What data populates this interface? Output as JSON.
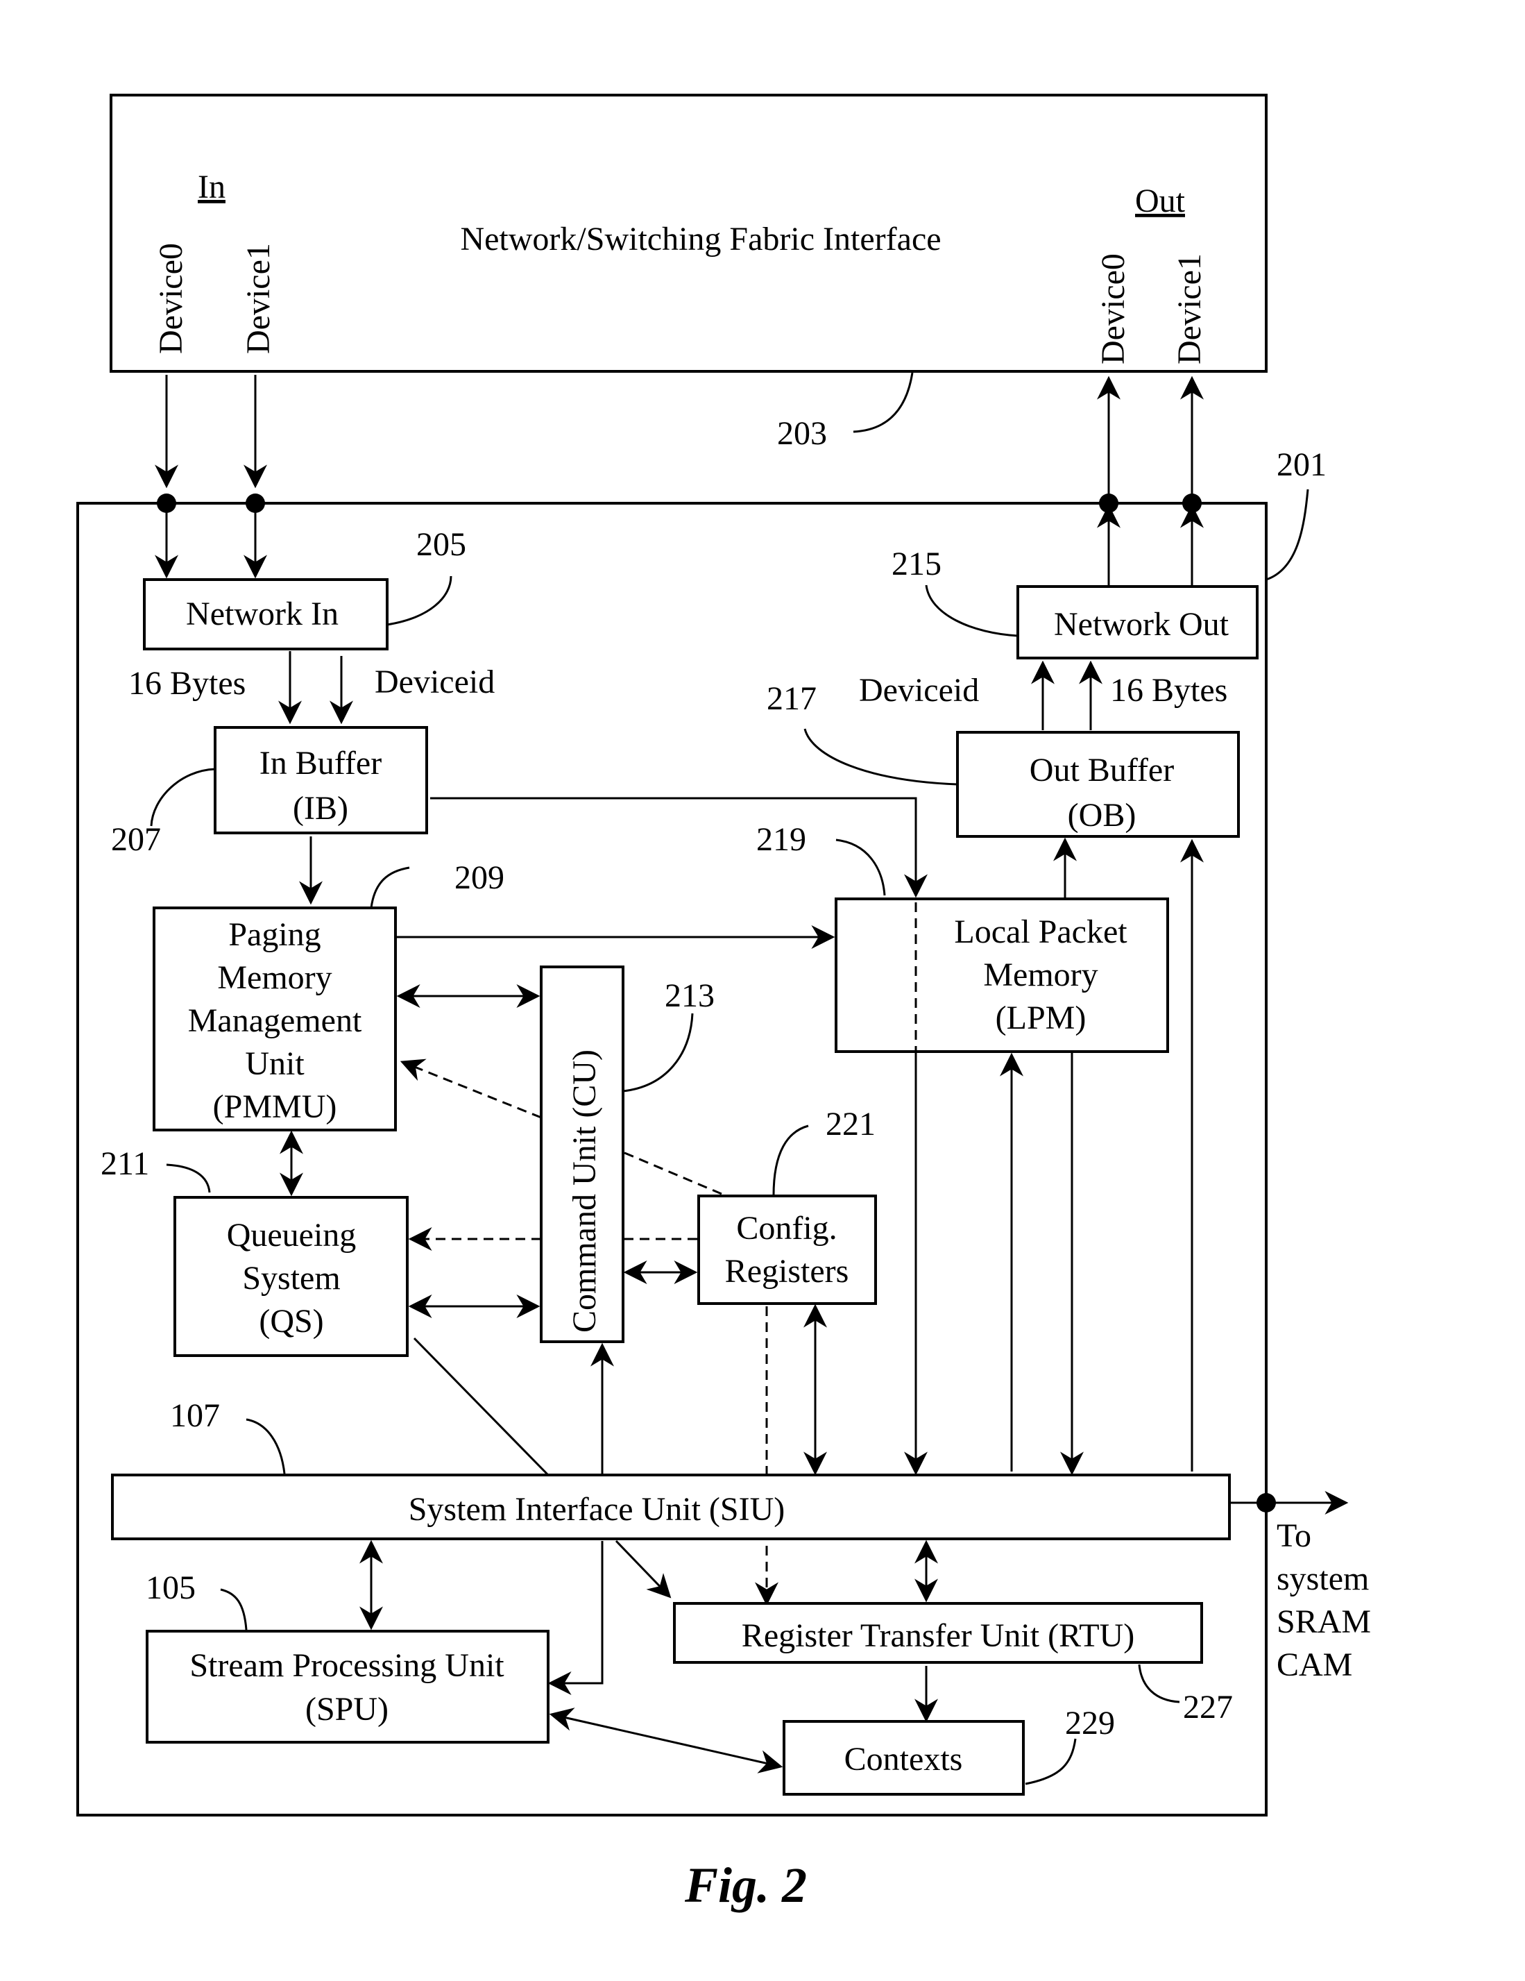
{
  "figure": {
    "caption": "Fig. 2"
  },
  "fabric": {
    "title": "Network/Switching Fabric Interface",
    "in_label": "In",
    "out_label": "Out",
    "in_devices": [
      "Device0",
      "Device1"
    ],
    "out_devices": [
      "Device0",
      "Device1"
    ],
    "ref": "203"
  },
  "chip": {
    "ref": "201"
  },
  "blocks": {
    "network_in": {
      "lines": [
        "Network In"
      ],
      "ref": "205"
    },
    "in_buffer": {
      "lines": [
        "In Buffer",
        "(IB)"
      ],
      "ref": "207"
    },
    "pmmu": {
      "lines": [
        "Paging",
        "Memory",
        "Management",
        "Unit",
        "(PMMU)"
      ],
      "ref": "209"
    },
    "qs": {
      "lines": [
        "Queueing",
        "System",
        "(QS)"
      ],
      "ref": "211"
    },
    "cu": {
      "lines": [
        "Command Unit (CU)"
      ],
      "ref": "213"
    },
    "network_out": {
      "lines": [
        "Network Out"
      ],
      "ref": "215"
    },
    "out_buffer": {
      "lines": [
        "Out Buffer",
        "(OB)"
      ],
      "ref": "217"
    },
    "lpm": {
      "lines": [
        "Local Packet",
        "Memory",
        "(LPM)"
      ],
      "ref": "219"
    },
    "config": {
      "lines": [
        "Config.",
        "Registers"
      ],
      "ref": "221"
    },
    "siu": {
      "lines": [
        "System Interface Unit (SIU)"
      ],
      "ref": "107"
    },
    "spu": {
      "lines": [
        "Stream Processing Unit",
        "(SPU)"
      ],
      "ref": "105"
    },
    "rtu": {
      "lines": [
        "Register Transfer Unit (RTU)"
      ],
      "ref": "227"
    },
    "contexts": {
      "lines": [
        "Contexts"
      ],
      "ref": "229"
    }
  },
  "signals": {
    "in_bytes": "16 Bytes",
    "in_deviceid": "Deviceid",
    "out_deviceid": "Deviceid",
    "out_bytes": "16 Bytes"
  },
  "external": {
    "lines": [
      "To",
      "system",
      "SRAM",
      "CAM"
    ]
  }
}
